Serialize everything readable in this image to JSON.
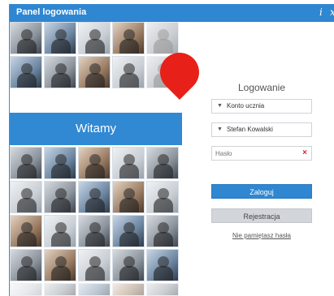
{
  "window": {
    "title": "Panel logowania",
    "info_icon": "i",
    "close_icon": "x"
  },
  "left": {
    "welcome": "Witamy"
  },
  "login": {
    "heading": "Logowanie",
    "account_type": "Konto ucznia",
    "user": "Stefan Kowalski",
    "password_placeholder": "Hasło",
    "login_button": "Zaloguj",
    "register_button": "Rejestracja",
    "forgot_link": "Nie pamiętasz hasła"
  },
  "colors": {
    "accent": "#2f86d1",
    "marker": "#e8201a",
    "clear": "#e22020"
  }
}
